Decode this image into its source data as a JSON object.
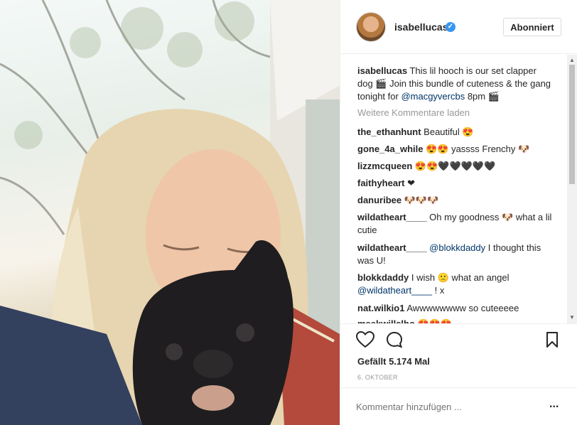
{
  "post": {
    "username": "isabellucas",
    "verified_icon": "verified-badge-icon",
    "follow_label": "Abonniert"
  },
  "caption": {
    "username": "isabellucas",
    "text_1": " This lil hooch is our set clapper dog 🎬 Join this bundle of cuteness & the gang tonight for ",
    "mention": "@macgyvercbs",
    "text_2": " 8pm 🎬"
  },
  "load_more": "Weitere Kommentare laden",
  "comments": [
    {
      "user": "the_ethanhunt",
      "text": " Beautiful 😍"
    },
    {
      "user": "gone_4a_while",
      "text": " 😍😍 yassss Frenchy 🐶"
    },
    {
      "user": "lizzmcqueen",
      "text": " 😍😍🖤🖤🖤🖤🖤"
    },
    {
      "user": "faithyheart",
      "text": " ❤"
    },
    {
      "user": "danuribee",
      "text": " 🐶🐶🐶"
    },
    {
      "user": "wildatheart____",
      "text": " Oh my goodness 🐶 what a lil cutie"
    },
    {
      "user": "wildatheart____",
      "mention": "@blokkdaddy",
      "text": " I thought this was U!"
    },
    {
      "user": "blokkdaddy",
      "text": " I wish 🙁 what an angel ",
      "mention": "@wildatheart____",
      "text_after": " ! x"
    },
    {
      "user": "nat.wilkio1",
      "text": " Awwwwwwww so cuteeeee"
    },
    {
      "user": "meekwillslho",
      "text": " 😍😍😍"
    }
  ],
  "likes": "Gefällt 5.174 Mal",
  "date": "6. OKTOBER",
  "add_comment_placeholder": "Kommentar hinzufügen ...",
  "more_options": "...",
  "colors": {
    "link": "#003569",
    "verified": "#3897f0",
    "muted": "#999999"
  }
}
